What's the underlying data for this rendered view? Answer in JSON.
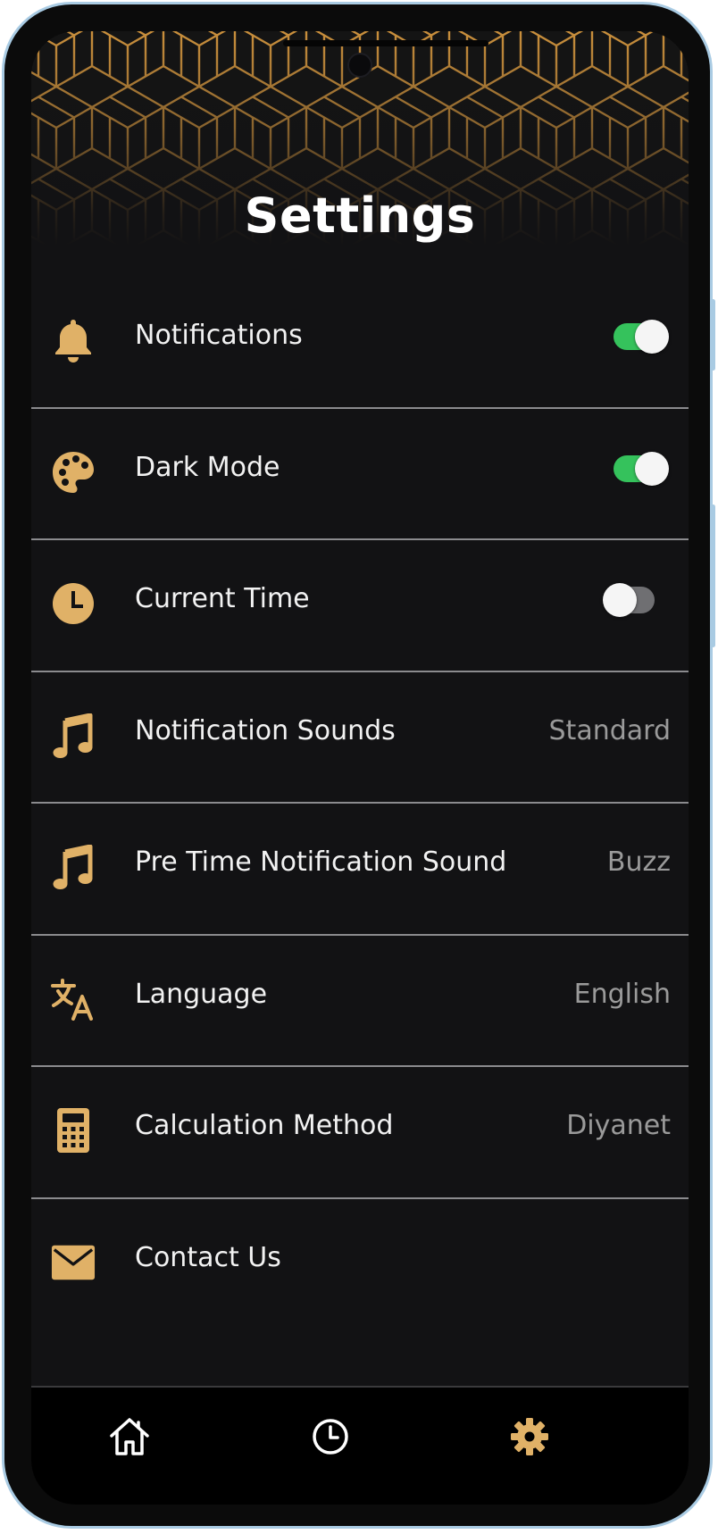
{
  "header": {
    "title": "Settings"
  },
  "settings": [
    {
      "label": "Notifications",
      "icon": "bell-icon",
      "control": "toggle",
      "enabled": true
    },
    {
      "label": "Dark Mode",
      "icon": "palette-icon",
      "control": "toggle",
      "enabled": true
    },
    {
      "label": "Current Time",
      "icon": "clock-icon",
      "control": "toggle",
      "enabled": false
    },
    {
      "label": "Notification Sounds",
      "icon": "music-note-icon",
      "value": "Standard"
    },
    {
      "label": "Pre Time Notification Sound",
      "icon": "music-note-icon",
      "value": "Buzz"
    },
    {
      "label": "Language",
      "icon": "translate-icon",
      "value": "English"
    },
    {
      "label": "Calculation Method",
      "icon": "calculator-icon",
      "value": "Diyanet"
    },
    {
      "label": "Contact Us",
      "icon": "envelope-icon"
    }
  ],
  "bottom_nav": [
    {
      "icon": "home-icon",
      "active": false
    },
    {
      "icon": "clock-icon",
      "active": false
    },
    {
      "icon": "gear-icon",
      "active": true
    }
  ],
  "colors": {
    "accent": "#e0b167",
    "background": "#121214",
    "toggle_on": "#35c25c",
    "toggle_off": "#6f6f72",
    "value_text": "#9a9a9a",
    "divider": "#8b8b8e"
  }
}
